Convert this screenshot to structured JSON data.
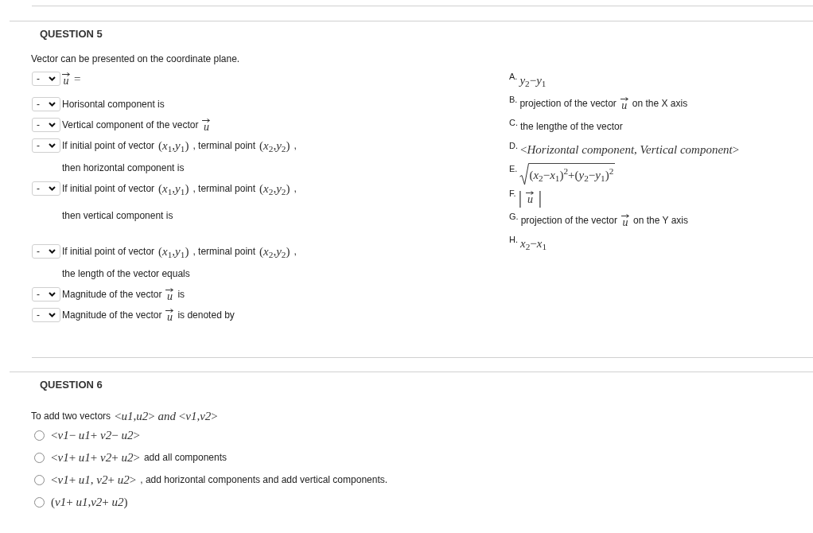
{
  "question_5": {
    "title": "QUESTION 5",
    "prompt": "Vector can be presented on the coordinate plane.",
    "statements": [
      {
        "value": "-",
        "lines": [
          [
            {
              "kind": "vector",
              "text": "u"
            },
            {
              "kind": "math",
              "text": "="
            }
          ]
        ]
      },
      {
        "value": "-",
        "lines": [
          [
            {
              "kind": "text",
              "text": "Horisontal component is"
            }
          ]
        ]
      },
      {
        "value": "-",
        "lines": [
          [
            {
              "kind": "text",
              "text": "Vertical component of the vector"
            },
            {
              "kind": "vector",
              "text": "u"
            }
          ]
        ]
      },
      {
        "value": "-",
        "lines": [
          [
            {
              "kind": "text",
              "text": "If initial point of vector"
            },
            {
              "kind": "math",
              "text": "(*x*$_{1}$,*y*$_{1}$)"
            },
            {
              "kind": "text",
              "text": ", terminal point"
            },
            {
              "kind": "math",
              "text": "(*x*$_{2}$,*y*$_{2}$)"
            },
            {
              "kind": "text",
              "text": ","
            }
          ],
          [
            {
              "kind": "text",
              "text": "then horizontal component is"
            }
          ]
        ]
      },
      {
        "value": "-",
        "lines": [
          [
            {
              "kind": "text",
              "text": "If initial point of vector"
            },
            {
              "kind": "math",
              "text": "(*x*$_{1}$,*y*$_{1}$)"
            },
            {
              "kind": "text",
              "text": ", terminal point"
            },
            {
              "kind": "math",
              "text": "(*x*$_{2}$,*y*$_{2}$)"
            },
            {
              "kind": "text",
              "text": ","
            }
          ],
          [
            {
              "kind": "text",
              "text": "then vertical component is"
            }
          ]
        ]
      },
      {
        "value": "-",
        "lines": [
          [
            {
              "kind": "text",
              "text": "If initial point of vector"
            },
            {
              "kind": "math",
              "text": "(*x*$_{1}$,*y*$_{1}$)"
            },
            {
              "kind": "text",
              "text": ", terminal point"
            },
            {
              "kind": "math",
              "text": "(*x*$_{2}$,*y*$_{2}$)"
            },
            {
              "kind": "text",
              "text": ","
            }
          ],
          [
            {
              "kind": "text",
              "text": "the length of the vector equals"
            }
          ]
        ]
      },
      {
        "value": "-",
        "lines": [
          [
            {
              "kind": "text",
              "text": "Magnitude of the vector"
            },
            {
              "kind": "vector",
              "text": "u"
            },
            {
              "kind": "text",
              "text": "is"
            }
          ]
        ]
      },
      {
        "value": "-",
        "lines": [
          [
            {
              "kind": "text",
              "text": "Magnitude of the vector"
            },
            {
              "kind": "vector",
              "text": "u"
            },
            {
              "kind": "text",
              "text": "is denoted by"
            }
          ]
        ]
      }
    ],
    "answers": [
      {
        "label": "A.",
        "content": [
          {
            "kind": "math",
            "text": "*y*$_{2}$−*y*$_{1}$"
          }
        ]
      },
      {
        "label": "B.",
        "content": [
          {
            "kind": "text",
            "text": "projection of the vector"
          },
          {
            "kind": "vector",
            "text": "u"
          },
          {
            "kind": "text",
            "text": "on the X axis"
          }
        ]
      },
      {
        "label": "C.",
        "content": [
          {
            "kind": "text",
            "text": "the lengthe of the vector"
          }
        ]
      },
      {
        "label": "D.",
        "content": [
          {
            "kind": "math",
            "text": "<*Horizontal component*, *Vertical component*>"
          }
        ]
      },
      {
        "label": "E.",
        "content": [
          {
            "kind": "sqrt",
            "text": "(*x*$_{2}$−*x*$_{1}$)$^{2}$+(*y*$_{2}$−*y*$_{1}$)$^{2}$"
          }
        ]
      },
      {
        "label": "F.",
        "content": [
          {
            "kind": "fence",
            "text": "|"
          },
          {
            "kind": "vector",
            "text": "u"
          },
          {
            "kind": "fence",
            "text": "|"
          }
        ]
      },
      {
        "label": "G.",
        "content": [
          {
            "kind": "text",
            "text": "projection of the vector"
          },
          {
            "kind": "vector",
            "text": "u"
          },
          {
            "kind": "text",
            "text": "on the Y axis"
          }
        ]
      },
      {
        "label": "H.",
        "content": [
          {
            "kind": "math",
            "text": "*x*$_{2}$−*x*$_{1}$"
          }
        ]
      }
    ]
  },
  "question_6": {
    "title": "QUESTION 6",
    "prompt": [
      {
        "kind": "text",
        "text": "To add two vectors"
      },
      {
        "kind": "math",
        "text": "<*u1*,*u2*> *and* <*v1*,*v2*>"
      }
    ],
    "options": [
      {
        "selected": false,
        "content": [
          {
            "kind": "math",
            "text": "<*v1*− *u1*+ *v2*− *u2*>"
          }
        ]
      },
      {
        "selected": false,
        "content": [
          {
            "kind": "math",
            "text": "<*v1*+ *u1*+ *v2*+ *u2*>"
          },
          {
            "kind": "text",
            "text": "add all components"
          }
        ]
      },
      {
        "selected": false,
        "content": [
          {
            "kind": "math",
            "text": "<*v1*+ *u1*, *v2*+ *u2*>"
          },
          {
            "kind": "text",
            "text": ", add horizontal components and add vertical components."
          }
        ]
      },
      {
        "selected": false,
        "content": [
          {
            "kind": "math",
            "text": "(*v1*+ *u1*,*v2*+ *u2*)"
          }
        ]
      }
    ]
  }
}
